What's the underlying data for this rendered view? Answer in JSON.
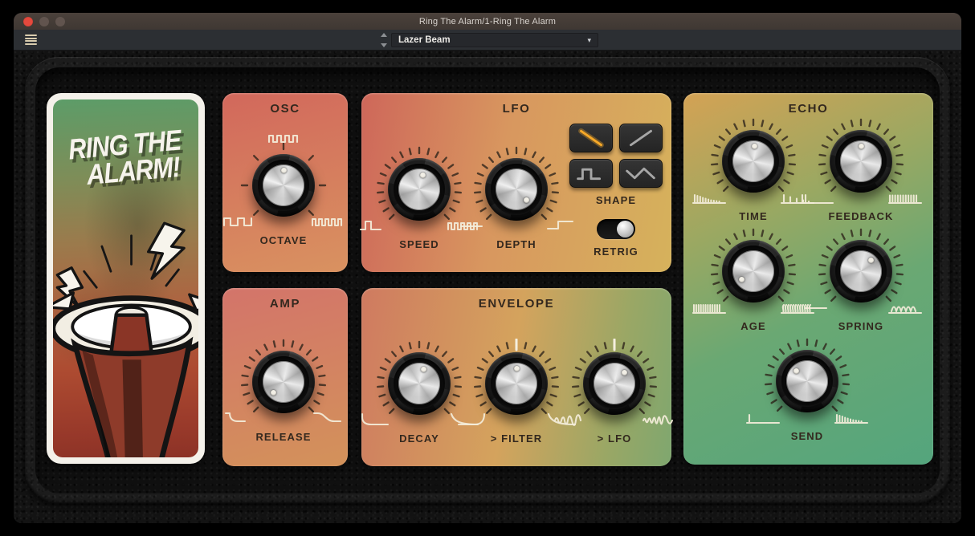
{
  "window": {
    "title": "Ring The Alarm/1-Ring The Alarm"
  },
  "toolbar": {
    "preset": "Lazer Beam",
    "caret": "▾"
  },
  "art": {
    "line1": "RING THE",
    "line2": "ALARM!"
  },
  "panels": {
    "osc": {
      "title": "OSC"
    },
    "lfo": {
      "title": "LFO",
      "shape_label": "SHAPE",
      "retrig_label": "RETRIG",
      "retrig_on": true,
      "shapes": [
        {
          "id": "saw-down",
          "selected": true
        },
        {
          "id": "saw-up",
          "selected": false
        },
        {
          "id": "square",
          "selected": false
        },
        {
          "id": "triangle",
          "selected": false
        }
      ]
    },
    "amp": {
      "title": "AMP"
    },
    "envelope": {
      "title": "ENVELOPE"
    },
    "echo": {
      "title": "ECHO"
    }
  },
  "knobs": [
    {
      "id": "octave",
      "label": "OCTAVE",
      "angle": 0,
      "ticks": 7,
      "icon_top": "sq-med",
      "icon_left": "sq-wide",
      "icon_right": "sq-dense"
    },
    {
      "id": "speed",
      "label": "SPEED",
      "angle": 14,
      "ticks": 21,
      "icon_left": "pulse-one",
      "icon_right": "sq-dense"
    },
    {
      "id": "depth",
      "label": "DEPTH",
      "angle": 136,
      "ticks": 21,
      "icon_left": "line-flat",
      "icon_right": "step-up"
    },
    {
      "id": "release",
      "label": "RELEASE",
      "angle": -136,
      "ticks": 21,
      "icon_left": "rel-fast",
      "icon_right": "rel-slow"
    },
    {
      "id": "decay",
      "label": "DECAY",
      "angle": 18,
      "ticks": 21,
      "icon_left": "dec-fast",
      "icon_right": "dec-slow"
    },
    {
      "id": "filter",
      "label": "> FILTER",
      "angle": 0,
      "ticks": 21,
      "white_top": true,
      "icon_left": "atk-up",
      "icon_right": "dec-slow"
    },
    {
      "id": "env-lfo",
      "label": "> LFO",
      "angle": 44,
      "ticks": 21,
      "white_top": true,
      "icon_left": "wave-up",
      "icon_right": "wave-down"
    },
    {
      "id": "time",
      "label": "TIME",
      "angle": 6,
      "ticks": 21,
      "icon_left": "bars-decay-dense",
      "icon_right": "bars-decay-sparse"
    },
    {
      "id": "feedback",
      "label": "FEEDBACK",
      "angle": 0,
      "ticks": 21,
      "icon_left": "bars-two",
      "icon_right": "bars-full"
    },
    {
      "id": "age",
      "label": "AGE",
      "angle": -126,
      "ticks": 21,
      "icon_left": "comb",
      "icon_right": "comb-aged"
    },
    {
      "id": "spring",
      "label": "SPRING",
      "angle": 42,
      "ticks": 21,
      "icon_left": "line-flat",
      "icon_right": "coil"
    },
    {
      "id": "send",
      "label": "SEND",
      "angle": -48,
      "ticks": 21,
      "icon_left": "bar-one",
      "icon_right": "bars-decay-dense"
    }
  ],
  "colors": {
    "shape_selected": "#f7a928",
    "shape_idle": "#a6a6a6",
    "icon_stroke": "#f4edda",
    "panel_text": "#33281e",
    "close_button": "#e5493d"
  }
}
